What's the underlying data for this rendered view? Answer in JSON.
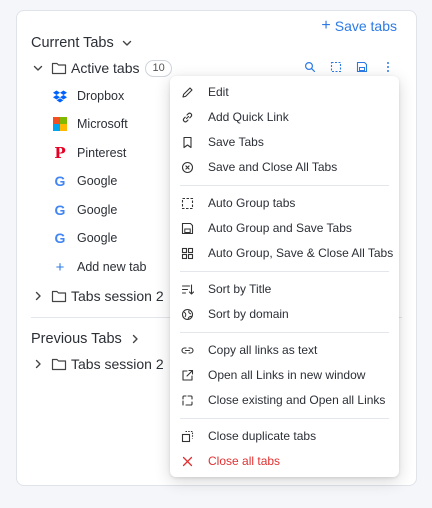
{
  "header": {
    "save_tabs_label": "Save tabs"
  },
  "current_tabs": {
    "title": "Current Tabs",
    "active_group": {
      "label": "Active tabs",
      "count": "10"
    },
    "tabs": [
      {
        "label": "Dropbox",
        "icon": "dropbox-icon"
      },
      {
        "label": "Microsoft",
        "icon": "microsoft-icon"
      },
      {
        "label": "Pinterest",
        "icon": "pinterest-icon"
      },
      {
        "label": "Google",
        "icon": "google-icon"
      },
      {
        "label": "Google",
        "icon": "google-icon"
      },
      {
        "label": "Google",
        "icon": "google-icon"
      }
    ],
    "add_new_tab": "Add new tab",
    "session_group": {
      "label": "Tabs session 2"
    }
  },
  "previous_tabs": {
    "title": "Previous Tabs",
    "session_group": {
      "label": "Tabs session 2"
    }
  },
  "context_menu": {
    "items": [
      {
        "label": "Edit",
        "icon": "pencil-icon"
      },
      {
        "label": "Add Quick Link",
        "icon": "link-icon"
      },
      {
        "label": "Save Tabs",
        "icon": "bookmark-icon"
      },
      {
        "label": "Save and Close All Tabs",
        "icon": "circle-x-icon"
      },
      {
        "label": "Auto Group tabs",
        "icon": "group-icon"
      },
      {
        "label": "Auto Group and Save Tabs",
        "icon": "save-icon"
      },
      {
        "label": "Auto Group, Save & Close All Tabs",
        "icon": "grid-icon"
      },
      {
        "label": "Sort by Title",
        "icon": "sort-icon"
      },
      {
        "label": "Sort by domain",
        "icon": "globe-icon"
      },
      {
        "label": "Copy all links as text",
        "icon": "link-text-icon"
      },
      {
        "label": "Open all Links in new window",
        "icon": "external-link-icon"
      },
      {
        "label": "Close existing and Open all Links",
        "icon": "dashed-arrow-icon"
      },
      {
        "label": "Close duplicate tabs",
        "icon": "duplicate-icon"
      },
      {
        "label": "Close all tabs",
        "icon": "close-icon"
      }
    ]
  },
  "colors": {
    "accent": "#2c7be5",
    "danger": "#e03131",
    "text": "#2b2f36"
  }
}
